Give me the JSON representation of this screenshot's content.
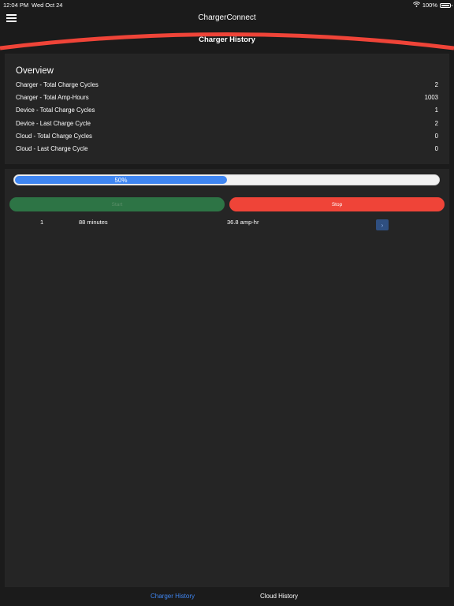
{
  "status_bar": {
    "time": "12:04 PM",
    "date": "Wed Oct 24",
    "battery": "100%",
    "icons": [
      "wifi-icon",
      "battery-icon"
    ]
  },
  "header": {
    "app_title": "ChargerConnect",
    "page_title": "Charger History",
    "menu_icon": "hamburger-menu-icon",
    "accent_color": "#ef4438"
  },
  "overview": {
    "title": "Overview",
    "rows": [
      {
        "label": "Charger - Total Charge Cycles",
        "value": "2"
      },
      {
        "label": "Charger - Total Amp-Hours",
        "value": "1003"
      },
      {
        "label": "Device - Total Charge Cycles",
        "value": "1"
      },
      {
        "label": "Device - Last Charge Cycle",
        "value": "2"
      },
      {
        "label": "Cloud - Total Charge Cycles",
        "value": "0"
      },
      {
        "label": "Cloud - Last Charge Cycle",
        "value": "0"
      }
    ]
  },
  "progress": {
    "label": "50%",
    "fraction": 0.5,
    "color": "#3f86f2"
  },
  "controls": {
    "start_label": "Start",
    "stop_label": "Stop",
    "start_color": "#2d7445",
    "stop_color": "#ef4438"
  },
  "history": [
    {
      "index": "1",
      "duration": "88 minutes",
      "amp_hours": "36.8 amp-hr",
      "action_icon": "chevron-right-icon"
    }
  ],
  "tabs": [
    {
      "label": "Charger History",
      "active": true
    },
    {
      "label": "Cloud History",
      "active": false
    }
  ]
}
